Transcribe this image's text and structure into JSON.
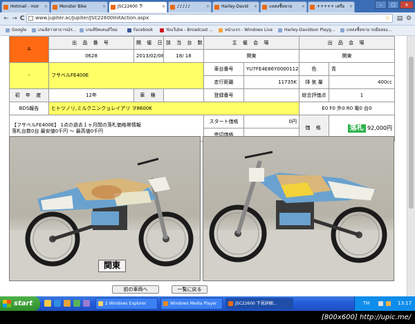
{
  "browser": {
    "tabs": [
      {
        "label": "Hotmail - mor",
        "active": false
      },
      {
        "label": "Monster Bike",
        "active": false
      },
      {
        "label": "JSC22600 下",
        "active": true
      },
      {
        "label": "♪♪♪♪♪",
        "active": false
      },
      {
        "label": "Harley-David",
        "active": false
      },
      {
        "label": "แหล่งซื้อขาย",
        "active": false
      },
      {
        "label": "+++++ เครื่อ",
        "active": false
      }
    ],
    "window_controls": {
      "min": "–",
      "max": "□",
      "close": "x"
    },
    "nav": {
      "back": "←",
      "forward": "→",
      "reload": "C"
    },
    "url": "www.jupiter.ac/Jupiter/JSC22600InitAction.aspx",
    "bookmarks": [
      "Google",
      "เกมส์สาวสาธารณ์ร่...",
      "เกมส์ปิคเคนส์ใหม่",
      "Facebook",
      "YouTube - Broadcast ...",
      "หน้าแรก - Windows Live",
      "Harley-Davidson Playg...",
      "แหล่งซื้อขาย รถมือสอง..."
    ]
  },
  "listing": {
    "grade": "A",
    "labels": {
      "lot_no": "出 品 番 号",
      "date": "開 催 日 付",
      "count": "該 当 台 数",
      "sponsor": "主 催 会 場",
      "venue": "出 品 会 場",
      "chassis": "車台番号",
      "color": "色",
      "mileage": "走行距離",
      "displacement": "排 気 量",
      "year": "初 年 度",
      "inspection": "車 検",
      "reg_no": "登録番号",
      "overall": "総合評価点",
      "bds": "BDS報告",
      "start_price": "スタート価格",
      "contract_price": "売切価格",
      "price": "価 格"
    },
    "values": {
      "lot_no": "0628",
      "date": "2013/02/08(金)",
      "count": "18/ 18",
      "sponsor": "関東",
      "venue": "関東",
      "model": "フサベルFE400E",
      "dash": "-",
      "chassis": "YU7FE4E86Y0000112",
      "color": "青",
      "mileage": "11735K",
      "displacement": "400cc",
      "year": "12年",
      "inspection": "",
      "reg_no": "",
      "overall": "1",
      "bds": "ヒトツノリ,ミルクニンクョレイアリ ヲ8600K",
      "engine_marks": "E0 F0 外0 R0 電0 台0",
      "history_line1": "【フサベルFE400E】 1点の過去１ヶ月間の落札価格帯情報",
      "history_line2": "落札台数0台 最安値0千円 ～ 最高値0千円",
      "start_price": "0円",
      "contract_price": "",
      "sold_badge": "落札",
      "price": "92,000円"
    },
    "photo_caption": "関東",
    "buttons": {
      "prev": "前の車両へ",
      "back_to_list": "一覧に戻る"
    }
  },
  "taskbar": {
    "start": "start",
    "tasks": [
      {
        "label": "2 Windows Explorer",
        "active": false
      },
      {
        "label": "Windows Media Player",
        "active": false
      },
      {
        "label": "JSC22600 下見詳細...",
        "active": true
      }
    ],
    "lang": "TH",
    "clock": "13:17"
  },
  "caption": "[800x600] http://upic.me/",
  "colors": {
    "grade_bg": "#ff6a12",
    "highlight": "#ffff66",
    "sold_green": "#2db34a",
    "bike_blue": "#6aa2cf"
  }
}
